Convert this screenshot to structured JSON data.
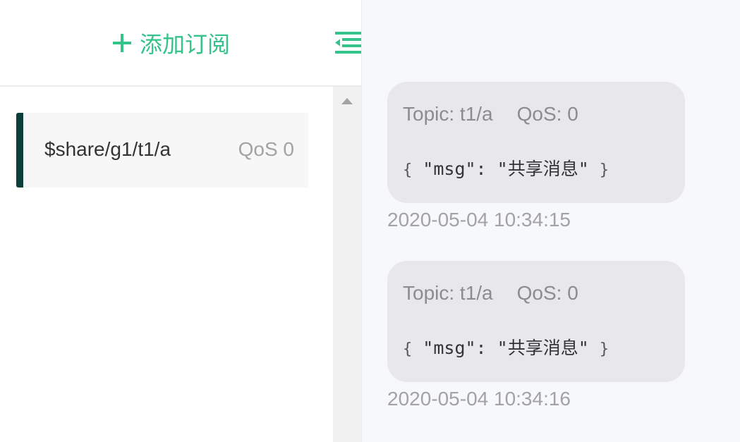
{
  "subscriptions": {
    "add_button_label": "添加订阅",
    "items": [
      {
        "topic": "$share/g1/t1/a",
        "qos": "QoS 0",
        "color": "#0d3e3a"
      }
    ]
  },
  "messages": {
    "items": [
      {
        "topic": "Topic: t1/a",
        "qos": "QoS: 0",
        "payload_open": "{",
        "payload_body": " \"msg\": \"共享消息\" ",
        "payload_close": "}",
        "time": "2020-05-04 10:34:15"
      },
      {
        "topic": "Topic: t1/a",
        "qos": "QoS: 0",
        "payload_open": "{",
        "payload_body": " \"msg\": \"共享消息\" ",
        "payload_close": "}",
        "time": "2020-05-04 10:34:16"
      }
    ]
  },
  "colors": {
    "accent": "#34c388",
    "subscription_bar": "#0d3e3a",
    "bubble_bg": "#e8e8ec",
    "panel_bg": "#f7f8fb"
  },
  "icons": {
    "add": "plus-icon",
    "collapse": "collapse-menu-icon",
    "scroll_up": "scroll-up-arrow-icon"
  }
}
